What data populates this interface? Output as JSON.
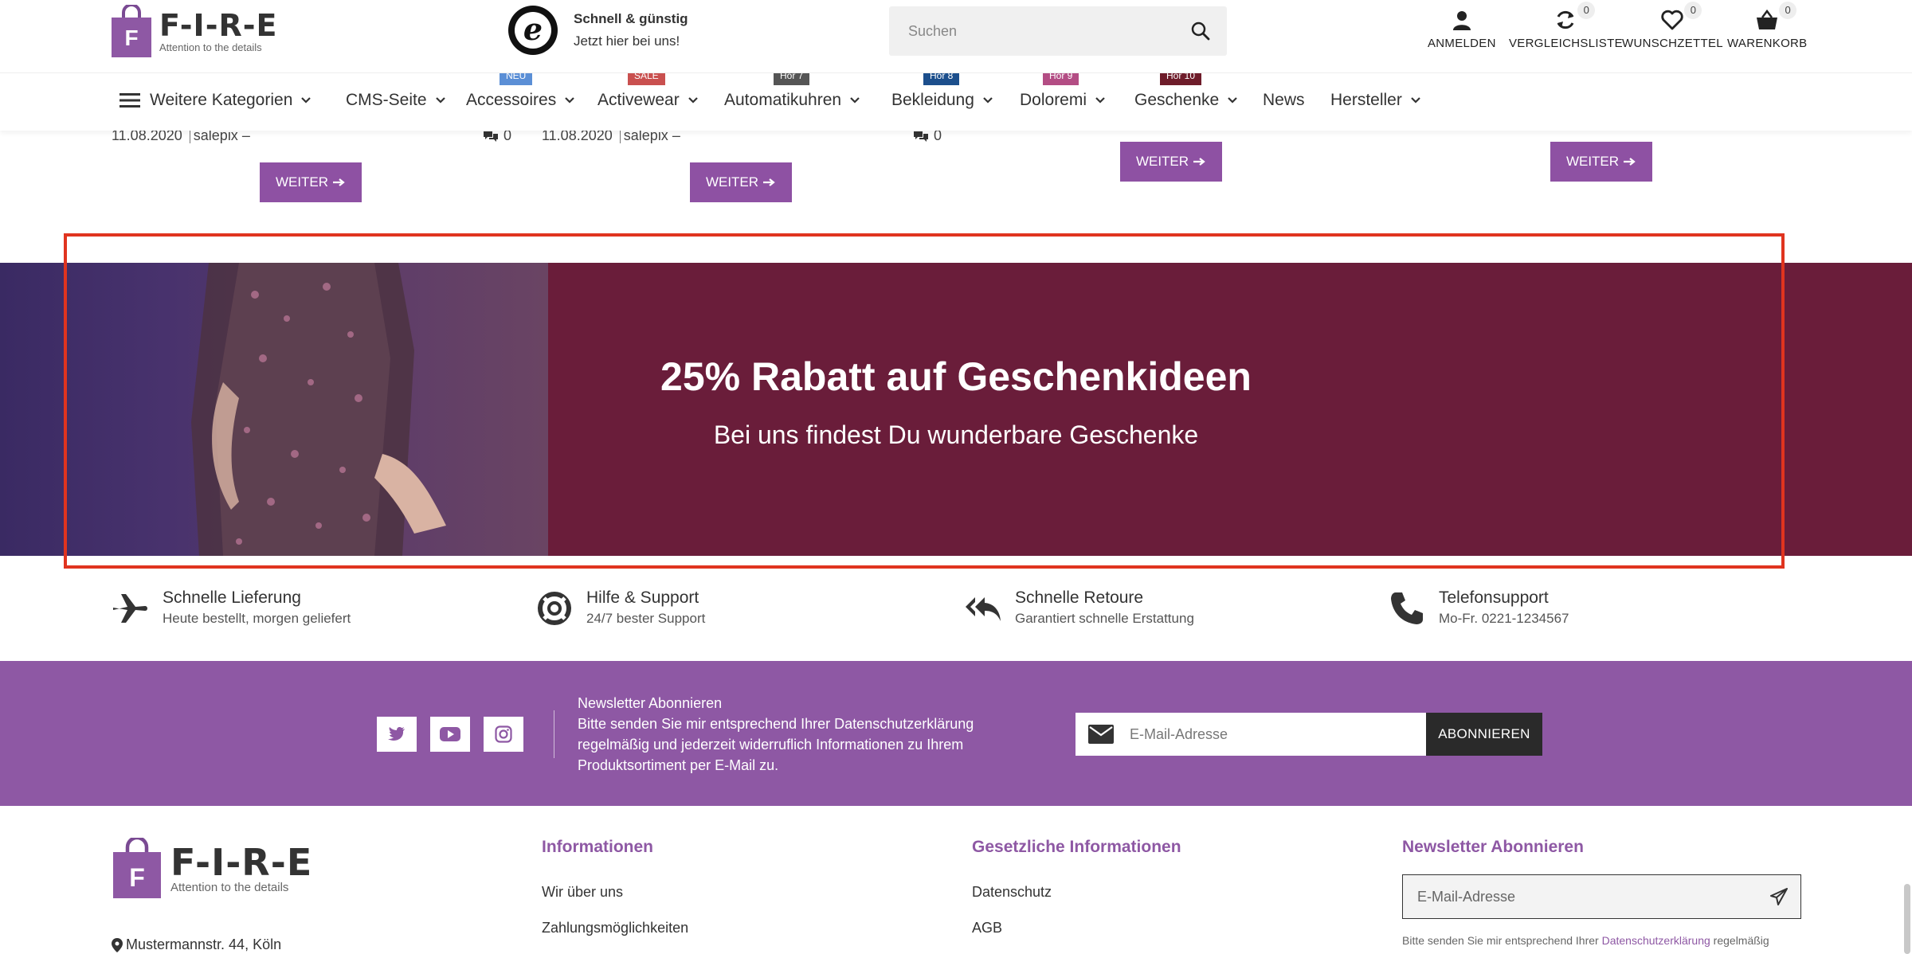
{
  "header": {
    "logo_word": "F-I-R-E",
    "logo_letter": "F",
    "logo_tagline": "Attention to the details",
    "trust_letter": "e",
    "trust_title": "Schnell & günstig",
    "trust_subtitle": "Jetzt hier bei uns!",
    "search_placeholder": "Suchen",
    "actions": {
      "login": "ANMELDEN",
      "compare": "VERGLEICHSLISTE",
      "compare_count": "0",
      "wishlist": "WUNSCHZETTEL",
      "wishlist_count": "0",
      "cart": "WARENKORB",
      "cart_count": "0"
    }
  },
  "nav": {
    "items": [
      {
        "label": "Weitere Kategorien"
      },
      {
        "label": "CMS-Seite"
      },
      {
        "label": "Accessoires",
        "badge": "NEU",
        "badge_color": "#5b8fd6"
      },
      {
        "label": "Activewear",
        "badge": "SALE",
        "badge_color": "#c9504f"
      },
      {
        "label": "Automatikuhren",
        "badge": "Hor 7",
        "badge_color": "#555555"
      },
      {
        "label": "Bekleidung",
        "badge": "Hor 8",
        "badge_color": "#1c4f8c"
      },
      {
        "label": "Doloremi",
        "badge": "Hor 9",
        "badge_color": "#b34d84"
      },
      {
        "label": "Geschenke",
        "badge": "Hor 10",
        "badge_color": "#6e1c2a"
      },
      {
        "label": "News"
      },
      {
        "label": "Hersteller"
      }
    ]
  },
  "blog": {
    "posts": [
      {
        "date": "11.08.2020",
        "author": "salepix",
        "dash": "–",
        "comments": "0"
      },
      {
        "date": "11.08.2020",
        "author": "salepix",
        "dash": "–",
        "comments": "0"
      }
    ],
    "button_label": "WEITER"
  },
  "banner": {
    "title": "25% Rabatt auf Geschenkideen",
    "subtitle": "Bei uns findest Du wunderbare Geschenke",
    "background": "#6a1d3a"
  },
  "usps": [
    {
      "title": "Schnelle Lieferung",
      "text": "Heute bestellt, morgen geliefert",
      "icon": "airplane-icon"
    },
    {
      "title": "Hilfe & Support",
      "text": "24/7 bester Support",
      "icon": "lifebuoy-icon"
    },
    {
      "title": "Schnelle Retoure",
      "text": "Garantiert schnelle Erstattung",
      "icon": "reply-all-icon"
    },
    {
      "title": "Telefonsupport",
      "text": "Mo-Fr. 0221-1234567",
      "icon": "phone-icon"
    }
  ],
  "newsletter_band": {
    "background": "#8e58a4",
    "title": "Newsletter Abonnieren",
    "text": "Bitte senden Sie mir entsprechend Ihrer Datenschutzerklärung regelmäßig und jederzeit widerruflich Informationen zu Ihrem Produktsortiment per E-Mail zu.",
    "email_placeholder": "E-Mail-Adresse",
    "submit_label": "ABONNIEREN",
    "social": [
      "twitter-icon",
      "youtube-icon",
      "instagram-icon"
    ]
  },
  "footer": {
    "address": "Mustermannstr. 44, Köln",
    "col_info_title": "Informationen",
    "col_info_links": [
      "Wir über uns",
      "Zahlungsmöglichkeiten"
    ],
    "col_legal_title": "Gesetzliche Informationen",
    "col_legal_links": [
      "Datenschutz",
      "AGB"
    ],
    "col_nl_title": "Newsletter Abonnieren",
    "nl_placeholder": "E-Mail-Adresse",
    "nl_note_prefix": "Bitte senden Sie mir entsprechend Ihrer",
    "nl_note_link": "Datenschutzerklärung",
    "nl_note_suffix": "regelmäßig"
  },
  "colors": {
    "brand_purple": "#8e51a3",
    "highlight_red": "#e0341f"
  }
}
